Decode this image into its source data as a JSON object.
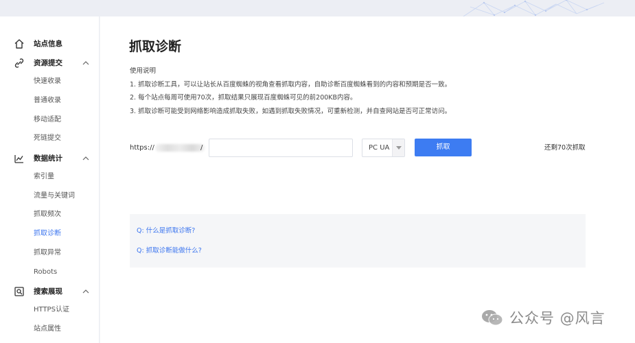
{
  "sidebar": {
    "groups": [
      {
        "label": "站点信息",
        "icon": "home-icon",
        "items": []
      },
      {
        "label": "资源提交",
        "icon": "link-icon",
        "items": [
          "快速收录",
          "普通收录",
          "移动适配",
          "死链提交"
        ]
      },
      {
        "label": "数据统计",
        "icon": "chart-icon",
        "items": [
          "索引量",
          "流量与关键词",
          "抓取频次",
          "抓取诊断",
          "抓取异常",
          "Robots"
        ]
      },
      {
        "label": "搜索展现",
        "icon": "search-frame-icon",
        "items": [
          "HTTPS认证",
          "站点属性"
        ]
      }
    ],
    "active_item": "抓取诊断"
  },
  "main": {
    "title": "抓取诊断",
    "usage": {
      "heading": "使用说明",
      "lines": [
        "1. 抓取诊断工具，可以让站长从百度蜘蛛的视角查看抓取内容，自助诊断百度蜘蛛看到的内容和预期是否一致。",
        "2. 每个站点每周可使用70次，抓取结果只展现百度蜘蛛可见的前200KB内容。",
        "3. 抓取诊断可能受到网络影响造成抓取失败，如遇到抓取失败情况，可重新检测，并自查网站是否可正常访问。"
      ]
    },
    "form": {
      "url_prefix": "https://",
      "url_slash": "/",
      "url_value": "",
      "ua_selected": "PC UA",
      "fetch_label": "抓取",
      "remaining": "还剩70次抓取"
    },
    "faq": [
      "Q: 什么是抓取诊断?",
      "Q: 抓取诊断能做什么?"
    ]
  },
  "watermark": {
    "text": "公众号 @风言",
    "icon": "wechat-icon"
  },
  "colors": {
    "accent": "#3d7cf2",
    "link": "#3a74ef",
    "sidebar_bg": "#ffffff",
    "page_bg": "#f3f4f7"
  }
}
